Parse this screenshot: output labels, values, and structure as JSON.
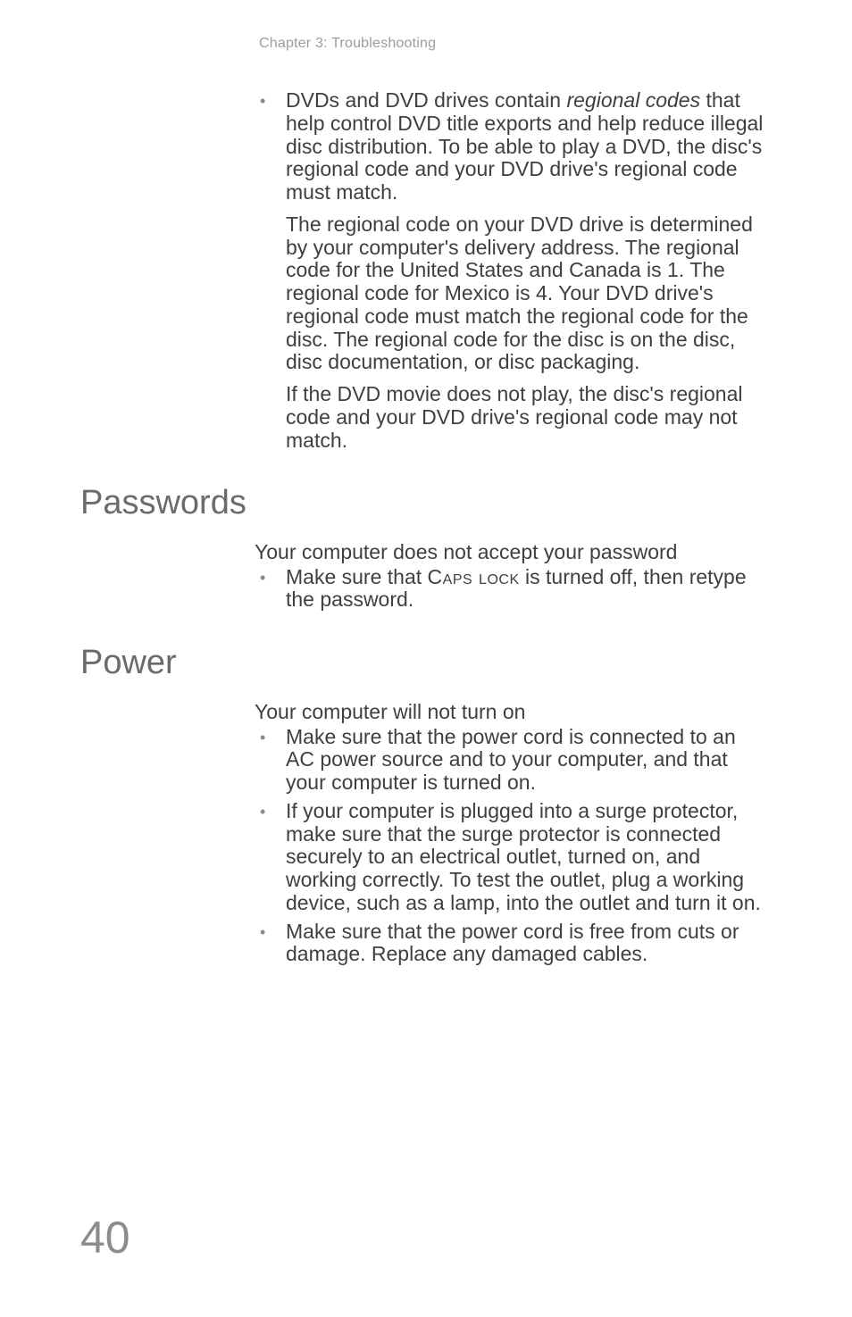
{
  "running_header": "Chapter 3: Troubleshooting",
  "top_bullet": {
    "part1": "DVDs and DVD drives contain ",
    "italic": "regional codes",
    "part2": " that help control DVD title exports and help reduce illegal disc distribution. To be able to play a DVD, the disc's regional code and your DVD drive's regional code must match."
  },
  "top_para1": "The regional code on your DVD drive is determined by your computer's delivery address. The regional code for the United States and Canada is 1. The regional code for Mexico is 4. Your DVD drive's regional code must match the regional code for the disc. The regional code for the disc is on the disc, disc documentation, or disc packaging.",
  "top_para2": "If the DVD movie does not play, the disc's regional code and your DVD drive's regional code may not match.",
  "passwords": {
    "heading": "Passwords",
    "sub_heading": "Your computer does not accept your password",
    "bullet_pre": "Make sure that ",
    "bullet_caps": "Caps lock",
    "bullet_post": " is turned off, then retype the password."
  },
  "power": {
    "heading": "Power",
    "sub_heading": "Your computer will not turn on",
    "bullets": [
      "Make sure that the power cord is connected to an AC power source and to your computer, and that your computer is turned on.",
      "If your computer is plugged into a surge protector, make sure that the surge protector is connected securely to an electrical outlet, turned on, and working correctly. To test the outlet, plug a working device, such as a lamp, into the outlet and turn it on.",
      "Make sure that the power cord is free from cuts or damage. Replace any damaged cables."
    ]
  },
  "page_number": "40"
}
